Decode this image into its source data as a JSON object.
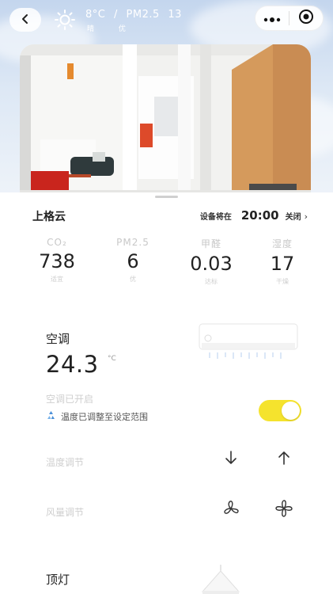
{
  "weather": {
    "temp": "8°C",
    "separator": "/",
    "pm_label": "PM2.5",
    "pm_value": "13",
    "condition": "晴",
    "air_quality": "优"
  },
  "room": {
    "name": "上格云",
    "schedule_label": "设备将在",
    "schedule_time": "20:00",
    "schedule_action": "关闭",
    "chevron": "›"
  },
  "metrics": [
    {
      "label": "CO₂",
      "value": "738",
      "sub": "适宜"
    },
    {
      "label": "PM2.5",
      "value": "6",
      "sub": "优"
    },
    {
      "label": "甲醛",
      "value": "0.03",
      "sub": "达标"
    },
    {
      "label": "湿度",
      "value": "17",
      "sub": "干燥"
    }
  ],
  "ac": {
    "title": "空调",
    "temperature": "24.3",
    "unit": "°C",
    "status": "空调已开启",
    "note": "温度已调整至设定范围",
    "power_on": true,
    "toggle_color": "#f5e32d"
  },
  "controls": {
    "temp_label": "温度调节",
    "fan_label": "风量调节"
  },
  "lamp": {
    "title": "顶灯"
  },
  "icons": {
    "back": "chevron-left-icon",
    "weather": "sun-icon",
    "more": "more-dots-icon",
    "close": "target-close-icon",
    "temp_down": "arrow-down-icon",
    "temp_up": "arrow-up-icon",
    "fan_low": "fan-small-icon",
    "fan_high": "fan-large-icon",
    "lamp": "ceiling-lamp-icon"
  }
}
